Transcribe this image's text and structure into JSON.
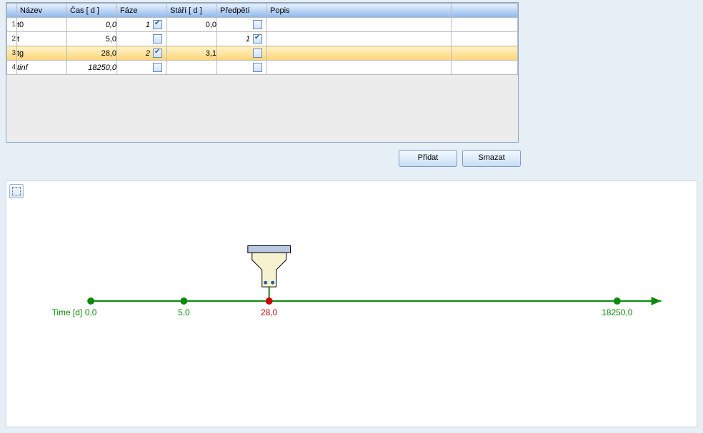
{
  "table": {
    "columns": {
      "rowhead": "",
      "name": "Název",
      "time": "Čas  [ d ]",
      "phase": "Fáze",
      "age": "Stáří  [ d ]",
      "pre": "Předpětí",
      "desc": "Popis",
      "last": ""
    },
    "rows": [
      {
        "n": "1",
        "name": "t0",
        "time": "0,0",
        "phase_val": "1",
        "phase_chk": true,
        "age": "0,0",
        "pre_val": "",
        "pre_chk": false,
        "desc": "",
        "selected": false,
        "name_italic": false,
        "time_italic": true
      },
      {
        "n": "2",
        "name": "t",
        "time": "5,0",
        "phase_val": "",
        "phase_chk": false,
        "age": "",
        "pre_val": "1",
        "pre_chk": true,
        "desc": "",
        "selected": false,
        "name_italic": false,
        "time_italic": false
      },
      {
        "n": "3",
        "name": "tg",
        "time": "28,0",
        "phase_val": "2",
        "phase_chk": true,
        "age": "3,1",
        "pre_val": "",
        "pre_chk": false,
        "desc": "",
        "selected": true,
        "name_italic": false,
        "time_italic": false
      },
      {
        "n": "4",
        "name": "tinf",
        "time": "18250,0",
        "phase_val": "",
        "phase_chk": false,
        "age": "",
        "pre_val": "",
        "pre_chk": false,
        "desc": "",
        "selected": false,
        "name_italic": true,
        "time_italic": true
      }
    ]
  },
  "buttons": {
    "add": "Přidat",
    "delete": "Smazat"
  },
  "timeline": {
    "axis_label": "Time [d]",
    "points": [
      {
        "x": 117,
        "label": "0,0",
        "active": false
      },
      {
        "x": 248,
        "label": "5,0",
        "active": false
      },
      {
        "x": 368,
        "label": "28,0",
        "active": true
      },
      {
        "x": 858,
        "label": "18250,0",
        "active": false
      }
    ],
    "arrow_end_x": 920,
    "line_y": 169
  },
  "chart_data": {
    "type": "timeline",
    "title": "",
    "xlabel": "Time [d]",
    "ylabel": "",
    "points": [
      {
        "name": "t0",
        "time_d": 0.0,
        "active": false
      },
      {
        "name": "t",
        "time_d": 5.0,
        "active": false
      },
      {
        "name": "tg",
        "time_d": 28.0,
        "active": true
      },
      {
        "name": "tinf",
        "time_d": 18250.0,
        "active": false
      }
    ],
    "xlim": [
      0,
      18250
    ]
  }
}
